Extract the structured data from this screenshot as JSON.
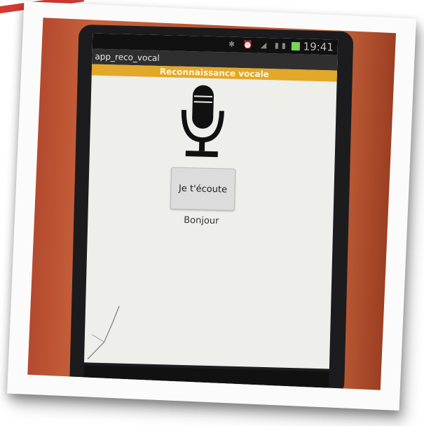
{
  "status_bar": {
    "clock": "19:41",
    "icons": [
      "bluetooth-icon",
      "alarm-icon",
      "wifi-icon",
      "signal-icon",
      "battery-icon"
    ],
    "battery_color": "#7bd15a"
  },
  "app": {
    "title": "app_reco_vocal",
    "header": "Reconnaissance vocale",
    "header_color": "#e2a82a"
  },
  "main": {
    "mic_icon": "microphone-icon",
    "listen_button_label": "Je t'écoute",
    "result_text": "Bonjour"
  },
  "colors": {
    "accent_red": "#d23a33",
    "screen_bg": "#eeeeea"
  }
}
